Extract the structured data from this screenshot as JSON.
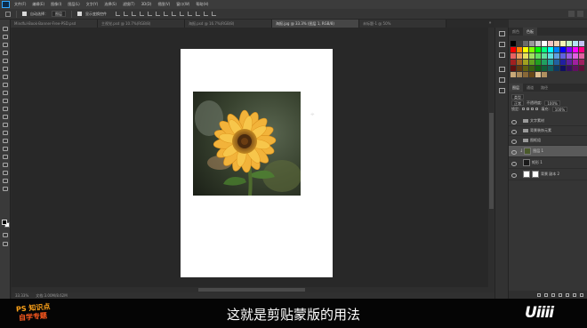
{
  "menubar": {
    "items": [
      "文件(F)",
      "编辑(E)",
      "图像(I)",
      "图层(L)",
      "文字(Y)",
      "选择(S)",
      "滤镜(T)",
      "3D(D)",
      "视图(V)",
      "窗口(W)",
      "帮助(H)"
    ]
  },
  "options": {
    "auto_select_label": "自动选择：",
    "auto_select_value": "图层",
    "show_transform_label": "显示变换控件"
  },
  "tabs": [
    {
      "label": "Mindful-Book-Banner-Free-PSD.psd",
      "active": false
    },
    {
      "label": "主视觉.psd @ 10.7%(RGB/8)",
      "active": false
    },
    {
      "label": "海报.psd @ 16.7%(RGB/8)",
      "active": false
    },
    {
      "label": "海报.jpg @ 33.3% (图层 1, RGB/8)",
      "active": true
    },
    {
      "label": "未标题-1 @ 50%",
      "active": false
    }
  ],
  "status": {
    "zoom": "33.33%",
    "doc_size": "文档:3.00M/8.62M"
  },
  "panels": {
    "color_tabs": [
      "颜色",
      "色板"
    ],
    "layer_tabs": [
      "图层",
      "通道",
      "路径"
    ],
    "filter_label": "类型",
    "blend_mode": "正常",
    "opacity_label": "不透明度:",
    "opacity_value": "100%",
    "lock_label": "锁定:",
    "fill_label": "填充:",
    "fill_value": "100%"
  },
  "layers": [
    {
      "name": "文字素材",
      "type": "group",
      "selected": false
    },
    {
      "name": "背景装饰元素",
      "type": "group",
      "selected": false
    },
    {
      "name": "图框组",
      "type": "group",
      "selected": false
    },
    {
      "name": "图层 1",
      "type": "photo",
      "selected": true,
      "clipped": true
    },
    {
      "name": "矩形 1",
      "type": "shape",
      "selected": false
    },
    {
      "name": "背景 副本 2",
      "type": "fill",
      "selected": false
    }
  ],
  "subtitle": "这就是剪贴蒙版的用法",
  "brand": {
    "line1": "PS 知识点",
    "line2": "自学专题"
  },
  "logo_text": "Uiiii",
  "colors": {
    "app_bg": "#2b2b2b",
    "panel_bg": "#353535",
    "selected_layer": "#5a5a5a",
    "brand_orange": "#ffa31a"
  }
}
